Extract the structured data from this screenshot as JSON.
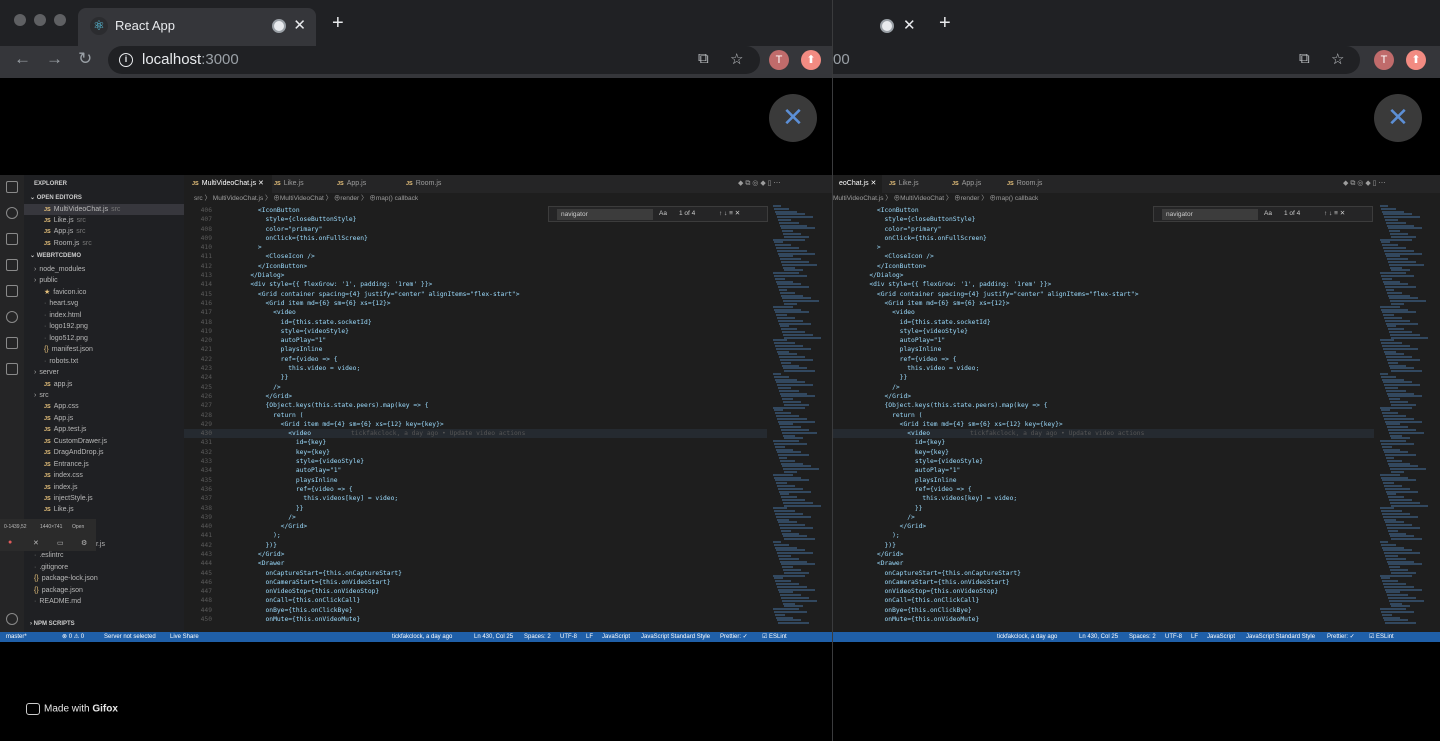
{
  "browser": {
    "tab_title": "React App",
    "tab_close": "✕",
    "new_tab": "+",
    "url_host": "localhost",
    "url_port": ":3000",
    "url_port_partial": "00",
    "profile_initial": "T",
    "back_glyph": "←",
    "forward_glyph": "→",
    "reload_glyph": "↻",
    "translate_glyph": "⧉",
    "star_glyph": "☆",
    "ext_glyph": "⬆",
    "info_glyph": "i"
  },
  "overlay": {
    "close_glyph": "✕"
  },
  "sidebar": {
    "title": "EXPLORER",
    "open_editors_label": "OPEN EDITORS",
    "open_editors": [
      {
        "name": "MultiVideoChat.js",
        "hint": "src"
      },
      {
        "name": "Like.js",
        "hint": "src"
      },
      {
        "name": "App.js",
        "hint": "src"
      },
      {
        "name": "Room.js",
        "hint": "src"
      }
    ],
    "project_label": "WEBRTCDEMO",
    "tree": [
      {
        "name": "node_modules",
        "kind": "folder",
        "indent": 1
      },
      {
        "name": "public",
        "kind": "folder",
        "indent": 1
      },
      {
        "name": "favicon.ico",
        "kind": "star",
        "indent": 2
      },
      {
        "name": "heart.svg",
        "kind": "file",
        "indent": 2
      },
      {
        "name": "index.html",
        "kind": "file",
        "indent": 2
      },
      {
        "name": "logo192.png",
        "kind": "file",
        "indent": 2
      },
      {
        "name": "logo512.png",
        "kind": "file",
        "indent": 2
      },
      {
        "name": "manifest.json",
        "kind": "json",
        "indent": 2
      },
      {
        "name": "robots.txt",
        "kind": "file",
        "indent": 2
      },
      {
        "name": "server",
        "kind": "folder",
        "indent": 1
      },
      {
        "name": "app.js",
        "kind": "js",
        "indent": 2
      },
      {
        "name": "src",
        "kind": "folder",
        "indent": 1
      },
      {
        "name": "App.css",
        "kind": "js",
        "indent": 2
      },
      {
        "name": "App.js",
        "kind": "js",
        "indent": 2
      },
      {
        "name": "App.test.js",
        "kind": "js",
        "indent": 2
      },
      {
        "name": "CustomDrawer.js",
        "kind": "js",
        "indent": 2
      },
      {
        "name": "DragAndDrop.js",
        "kind": "js",
        "indent": 2
      },
      {
        "name": "Entrance.js",
        "kind": "js",
        "indent": 2
      },
      {
        "name": "index.css",
        "kind": "js",
        "indent": 2
      },
      {
        "name": "index.js",
        "kind": "js",
        "indent": 2
      },
      {
        "name": "injectStyle.js",
        "kind": "js",
        "indent": 2
      },
      {
        "name": "Like.js",
        "kind": "js",
        "indent": 2
      },
      {
        "name": "",
        "kind": "file",
        "indent": 2
      },
      {
        "name": "",
        "kind": "file",
        "indent": 2
      },
      {
        "name": "serviceWorker.js",
        "kind": "js",
        "indent": 2
      },
      {
        "name": ".eslintrc",
        "kind": "file",
        "indent": 1
      },
      {
        "name": ".gitignore",
        "kind": "file",
        "indent": 1
      },
      {
        "name": "package-lock.json",
        "kind": "json",
        "indent": 1
      },
      {
        "name": "package.json",
        "kind": "json",
        "indent": 1
      },
      {
        "name": "README.md",
        "kind": "file",
        "indent": 1
      }
    ],
    "npm_scripts": "NPM SCRIPTS"
  },
  "editor": {
    "tabs": [
      "MultiVideoChat.js",
      "Like.js",
      "App.js",
      "Room.js"
    ],
    "tabs_right": [
      "eoChat.js",
      "Like.js",
      "App.js",
      "Room.js"
    ],
    "breadcrumbs": "src 〉 MultiVideoChat.js 〉 ⊕MultiVideoChat 〉 ⊕render 〉 ⊕map() callback",
    "breadcrumbs_right": "MultiVideoChat.js 〉 ⊕MultiVideoChat 〉 ⊕render 〉 ⊕map() callback",
    "find_query": "navigator",
    "find_count": "1 of 4",
    "blame": "tickfakclock, a day ago • Update video actions",
    "lines": [
      {
        "n": "406",
        "t": "          <IconButton"
      },
      {
        "n": "407",
        "t": "            style={closeButtonStyle}"
      },
      {
        "n": "408",
        "t": "            color=\"primary\""
      },
      {
        "n": "409",
        "t": "            onClick={this.onFullScreen}"
      },
      {
        "n": "410",
        "t": "          >"
      },
      {
        "n": "411",
        "t": "            <CloseIcon />"
      },
      {
        "n": "412",
        "t": "          </IconButton>"
      },
      {
        "n": "413",
        "t": "        </Dialog>"
      },
      {
        "n": "414",
        "t": "        <div style={{ flexGrow: '1', padding: '1rem' }}>"
      },
      {
        "n": "415",
        "t": "          <Grid container spacing={4} justify=\"center\" alignItems=\"flex-start\">"
      },
      {
        "n": "416",
        "t": "            <Grid item md={6} sm={6} xs={12}>"
      },
      {
        "n": "417",
        "t": "              <video"
      },
      {
        "n": "418",
        "t": "                id={this.state.socketId}"
      },
      {
        "n": "419",
        "t": "                style={videoStyle}"
      },
      {
        "n": "420",
        "t": "                autoPlay=\"1\""
      },
      {
        "n": "421",
        "t": "                playsInline"
      },
      {
        "n": "422",
        "t": "                ref={video => {"
      },
      {
        "n": "423",
        "t": "                  this.video = video;"
      },
      {
        "n": "424",
        "t": "                }}"
      },
      {
        "n": "425",
        "t": "              />"
      },
      {
        "n": "426",
        "t": "            </Grid>"
      },
      {
        "n": "427",
        "t": "            {Object.keys(this.state.peers).map(key => {"
      },
      {
        "n": "428",
        "t": "              return ("
      },
      {
        "n": "429",
        "t": "                <Grid item md={4} sm={6} xs={12} key={key}>"
      },
      {
        "n": "430",
        "t": "                  <video",
        "blame": true
      },
      {
        "n": "431",
        "t": "                    id={key}"
      },
      {
        "n": "432",
        "t": "                    key={key}"
      },
      {
        "n": "433",
        "t": "                    style={videoStyle}"
      },
      {
        "n": "434",
        "t": "                    autoPlay=\"1\""
      },
      {
        "n": "435",
        "t": "                    playsInline"
      },
      {
        "n": "436",
        "t": "                    ref={video => {"
      },
      {
        "n": "437",
        "t": "                      this.videos[key] = video;"
      },
      {
        "n": "438",
        "t": "                    }}"
      },
      {
        "n": "439",
        "t": "                  />"
      },
      {
        "n": "440",
        "t": "                </Grid>"
      },
      {
        "n": "441",
        "t": "              );"
      },
      {
        "n": "442",
        "t": "            })}"
      },
      {
        "n": "443",
        "t": "          </Grid>"
      },
      {
        "n": "444",
        "t": "          <Drawer"
      },
      {
        "n": "445",
        "t": "            onCaptureStart={this.onCaptureStart}"
      },
      {
        "n": "446",
        "t": "            onCameraStart={this.onVideoStart}"
      },
      {
        "n": "447",
        "t": "            onVideoStop={this.onVideoStop}"
      },
      {
        "n": "448",
        "t": "            onCall={this.onClickCall}"
      },
      {
        "n": "449",
        "t": "            onBye={this.onClickBye}"
      },
      {
        "n": "450",
        "t": "            onMute={this.onVideoMute}"
      }
    ]
  },
  "status": {
    "branch": "master*",
    "problems": "⊗ 0 ⚠ 0",
    "server": "Server not selected",
    "live": "Live Share",
    "blame": "tickfakclock, a day ago",
    "position": "Ln 430, Col 25",
    "spaces": "Spaces: 2",
    "encoding": "UTF-8",
    "eol": "LF",
    "language": "JavaScript",
    "style": "JavaScript Standard Style",
    "prettier": "Prettier: ✓",
    "eslint": "☑ ESLint"
  },
  "recorder": {
    "coords": "0-1439,52",
    "size": "1440×741",
    "open": "Open"
  },
  "watermark": {
    "prefix": "Made with ",
    "brand": "Gifox"
  }
}
